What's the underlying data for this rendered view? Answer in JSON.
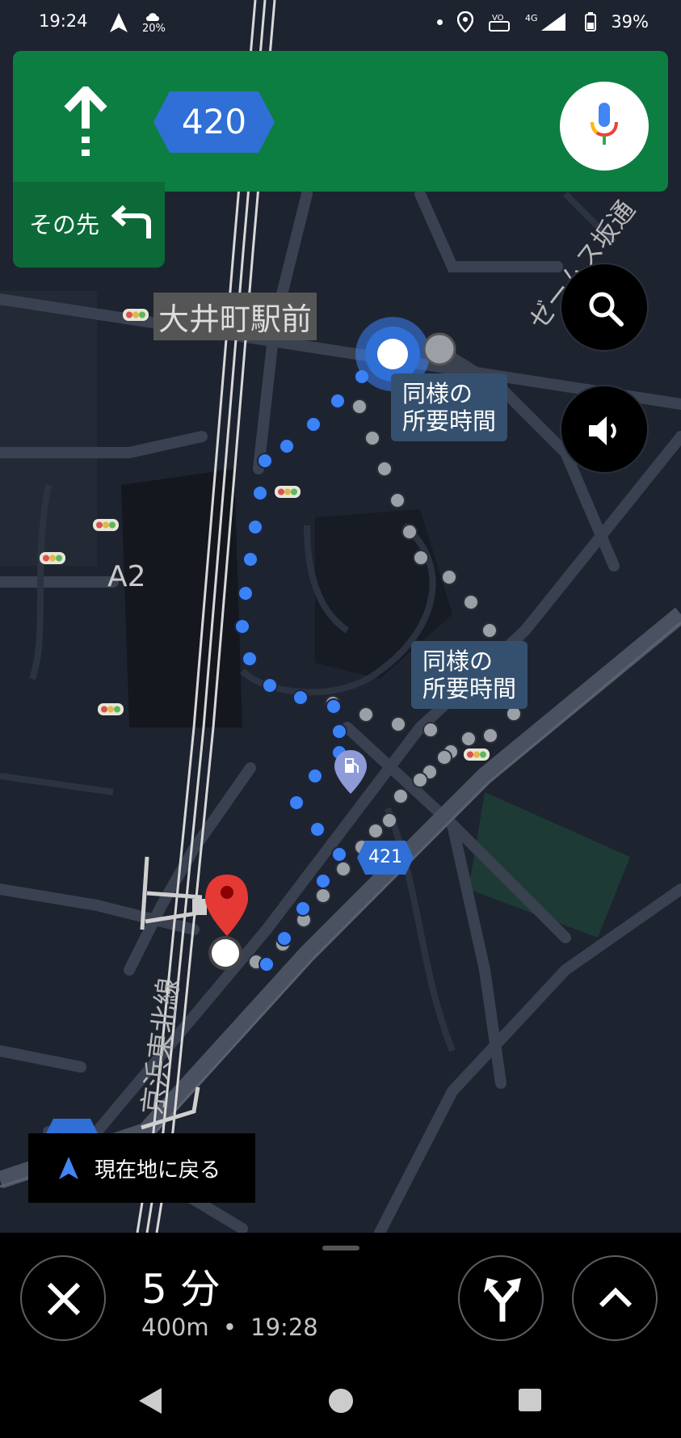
{
  "status_bar": {
    "time": "19:24",
    "weather_pct": "20%",
    "battery": "39%",
    "network": "4G"
  },
  "nav": {
    "road_number": "420",
    "then_label": "その先"
  },
  "map": {
    "station_label": "大井町駅前",
    "area_label": "A2",
    "rail_line_label": "京浜東北線",
    "street_label": "ゼームス坂通",
    "callout_1": "同様の\n所要時間",
    "callout_2": "同様の\n所要時間",
    "route_shield_421": "421",
    "route_shield_partial": "421"
  },
  "recenter": {
    "label": "現在地に戻る"
  },
  "trip": {
    "duration": "5 分",
    "distance": "400m",
    "separator": "•",
    "arrival": "19:28"
  },
  "colors": {
    "nav_green": "#0c7e41",
    "route_blue": "#3b82f6",
    "alt_route_gray": "#9aa0a6",
    "map_bg": "#1e2330",
    "destination_red": "#e53935"
  }
}
